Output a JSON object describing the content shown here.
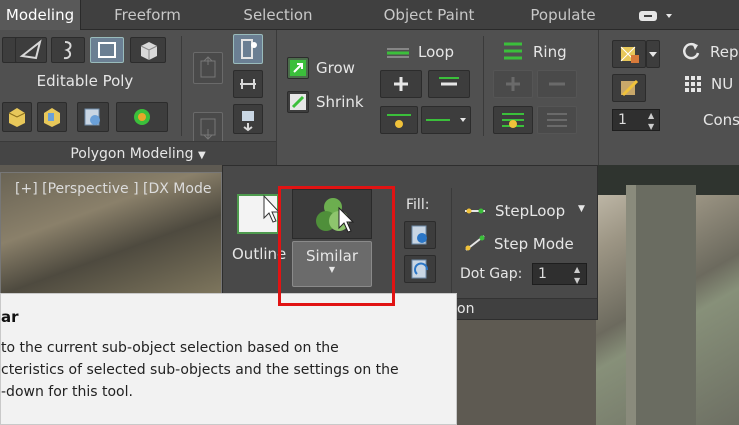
{
  "tabs": [
    {
      "label": "Modeling",
      "active": true
    },
    {
      "label": "Freeform"
    },
    {
      "label": "Selection"
    },
    {
      "label": "Object Paint"
    },
    {
      "label": "Populate"
    }
  ],
  "ribbon": {
    "editable_poly": "Editable Poly",
    "polygon_modeling": "Polygon Modeling",
    "grow": "Grow",
    "shrink": "Shrink",
    "loop": "Loop",
    "ring": "Ring",
    "rep": "Rep",
    "nu": "NU",
    "cons": "Cons",
    "spinner_value": "1"
  },
  "viewport": {
    "label": "[+] [Perspective ] [DX Mode"
  },
  "flyout": {
    "outline": "Outline",
    "similar": "Similar",
    "fill": "Fill:",
    "steploop": "StepLoop",
    "step_mode": "Step Mode",
    "dot_gap_label": "Dot Gap:",
    "dot_gap_value": "1",
    "footer_fragment": "on"
  },
  "tooltip": {
    "title": "ar",
    "line1": "to the current sub-object selection based on the",
    "line2": "cteristics of selected sub-objects and the settings on the",
    "line3": "-down for this tool."
  },
  "colors": {
    "highlight_box": "#e11313",
    "ribbon_bg": "#505050",
    "accent_green": "#3bbf3b"
  }
}
